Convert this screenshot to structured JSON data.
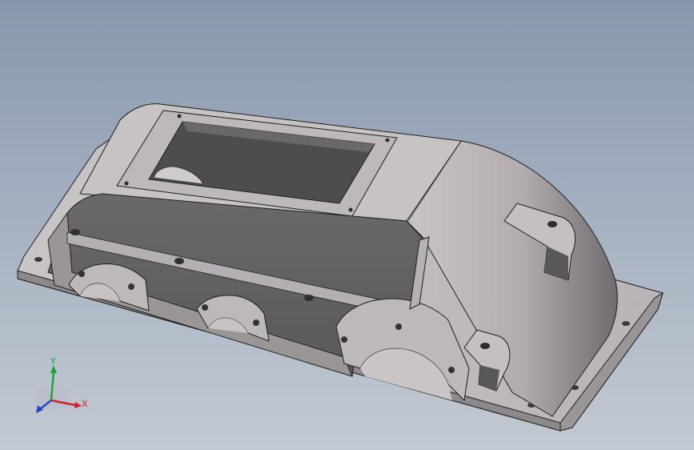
{
  "viewport": {
    "background_top": "#8797ad",
    "background_bottom": "#c3c9d2"
  },
  "model": {
    "face_light": "#c2bcbf",
    "face_mid": "#a49ea1",
    "face_dark": "#6d6a6b",
    "inner": "#575656",
    "edge": "#1e1e1e"
  },
  "triad": {
    "x_label": "X",
    "y_label": "Y",
    "x_color": "#d2202a",
    "y_color": "#21a33a",
    "z_color": "#2a44c8"
  }
}
